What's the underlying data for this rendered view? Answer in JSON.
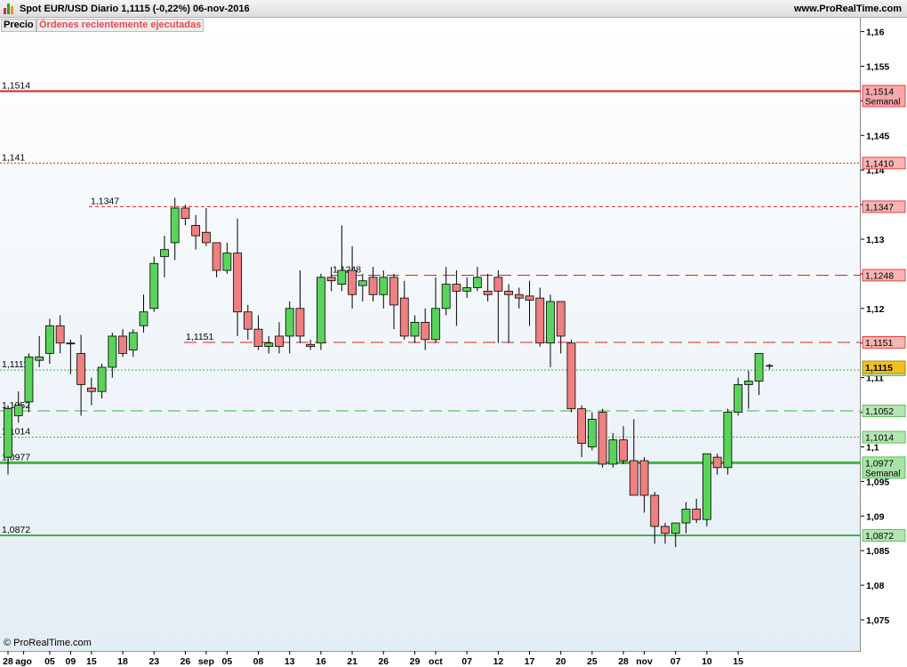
{
  "header": {
    "title": "Spot EUR/USD   Diario   1,1115 (-0,22%)   06-nov-2016",
    "site": "www.ProRealTime.com"
  },
  "tabs": {
    "price": "Precio",
    "orders": "Órdenes recientemente ejecutadas"
  },
  "footer": {
    "credit": "© ProRealTime.com"
  },
  "colors": {
    "up": "#5ad35a",
    "down": "#ef8080",
    "resistance": "#e02020",
    "support": "#3cb83c"
  },
  "chart_data": {
    "type": "candlestick",
    "title": "Spot EUR/USD",
    "period": "Diario",
    "last": "1,1115",
    "change": "-0,22%",
    "date": "06-nov-2016",
    "y_range": [
      1.0705,
      1.162
    ],
    "y_ticks": [
      "1,16",
      "1,155",
      "1,15",
      "1,145",
      "1,14",
      "1,135",
      "1,13",
      "1,125",
      "1,12",
      "1,115",
      "1,11",
      "1,105",
      "1,1",
      "1,095",
      "1,09",
      "1,085",
      "1,08",
      "1,075"
    ],
    "y_tick_values": [
      1.16,
      1.155,
      1.15,
      1.145,
      1.14,
      1.135,
      1.13,
      1.125,
      1.12,
      1.115,
      1.11,
      1.105,
      1.1,
      1.095,
      1.09,
      1.085,
      1.08,
      1.075
    ],
    "x_ticks": [
      {
        "label": "28",
        "i": 0
      },
      {
        "label": "ago",
        "i": 1.5
      },
      {
        "label": "05",
        "i": 4
      },
      {
        "label": "09",
        "i": 6
      },
      {
        "label": "15",
        "i": 8
      },
      {
        "label": "18",
        "i": 11
      },
      {
        "label": "23",
        "i": 14
      },
      {
        "label": "26",
        "i": 17
      },
      {
        "label": "sep",
        "i": 19
      },
      {
        "label": "05",
        "i": 21
      },
      {
        "label": "08",
        "i": 24
      },
      {
        "label": "13",
        "i": 27
      },
      {
        "label": "16",
        "i": 30
      },
      {
        "label": "21",
        "i": 33
      },
      {
        "label": "26",
        "i": 36
      },
      {
        "label": "29",
        "i": 39
      },
      {
        "label": "oct",
        "i": 41
      },
      {
        "label": "07",
        "i": 44
      },
      {
        "label": "12",
        "i": 47
      },
      {
        "label": "17",
        "i": 50
      },
      {
        "label": "20",
        "i": 53
      },
      {
        "label": "25",
        "i": 56
      },
      {
        "label": "28",
        "i": 59
      },
      {
        "label": "nov",
        "i": 61
      },
      {
        "label": "07",
        "i": 64
      },
      {
        "label": "10",
        "i": 67
      },
      {
        "label": "15",
        "i": 70
      }
    ],
    "levels": [
      {
        "value": 1.1514,
        "label": "1,1514",
        "tag": "1,1514",
        "tag2": "Semanal",
        "color": "#e02020",
        "style": "solid",
        "width": 2,
        "label_x": 0,
        "tag_bg": "#f6a8a8"
      },
      {
        "value": 1.141,
        "label": "1,141",
        "tag": "1,1410",
        "color": "#e02020",
        "style": "dotted",
        "width": 1,
        "label_x": 0,
        "tag_bg": "#f6b4b4"
      },
      {
        "value": 1.1347,
        "label": "1,1347",
        "tag": "1,1347",
        "color": "#e02020",
        "style": "dashed-short",
        "width": 1,
        "label_x": 100,
        "tag_bg": "#f6b4b4"
      },
      {
        "value": 1.1248,
        "label": "1,1248",
        "tag": "1,1248",
        "color": "#e02020",
        "style": "dashed-long",
        "width": 1,
        "label_x": 372,
        "tag_bg": "#f6b4b4"
      },
      {
        "value": 1.1151,
        "label": "1,1151",
        "tag": "1,1151",
        "color": "#e02020",
        "style": "dashed-long",
        "width": 1,
        "label_x": 207,
        "tag_bg": "#f6b4b4"
      },
      {
        "value": 1.1111,
        "label": "1,1111",
        "tag": "1,1111",
        "color": "#3cb83c",
        "style": "dotted",
        "width": 1,
        "label_x": 0,
        "tag_bg": "#b4e6b4"
      },
      {
        "value": 1.1052,
        "label": "1,1052",
        "tag": "1,1052",
        "color": "#3cb83c",
        "style": "dashed-long",
        "width": 1,
        "label_x": 0,
        "tag_bg": "#b4e6b4"
      },
      {
        "value": 1.1014,
        "label": "1,1014",
        "tag": "1,1014",
        "color": "#3cb83c",
        "style": "dotted",
        "width": 1,
        "label_x": 0,
        "tag_bg": "#b4e6b4"
      },
      {
        "value": 1.0977,
        "label": "1,0977",
        "tag": "1,0977",
        "tag2": "Semanal",
        "color": "#3cb83c",
        "style": "solid",
        "width": 3,
        "label_x": 0,
        "tag_bg": "#a8e2a8"
      },
      {
        "value": 1.0872,
        "label": "1,0872",
        "tag": "1,0872",
        "color": "#3cb83c",
        "style": "solid",
        "width": 2,
        "label_x": 0,
        "tag_bg": "#b4e6b4"
      }
    ],
    "current_price": {
      "value": 1.1115,
      "tag": "1,1115",
      "bg": "#f0c020"
    },
    "candles": [
      {
        "o": 1.0985,
        "h": 1.106,
        "l": 1.096,
        "c": 1.1055
      },
      {
        "o": 1.1045,
        "h": 1.108,
        "l": 1.1035,
        "c": 1.106
      },
      {
        "o": 1.1065,
        "h": 1.1135,
        "l": 1.105,
        "c": 1.113
      },
      {
        "o": 1.1125,
        "h": 1.116,
        "l": 1.1115,
        "c": 1.113
      },
      {
        "o": 1.1135,
        "h": 1.1185,
        "l": 1.112,
        "c": 1.1175
      },
      {
        "o": 1.1175,
        "h": 1.119,
        "l": 1.1135,
        "c": 1.115
      },
      {
        "o": 1.115,
        "h": 1.1155,
        "l": 1.1105,
        "c": 1.115
      },
      {
        "o": 1.1135,
        "h": 1.1162,
        "l": 1.1045,
        "c": 1.109
      },
      {
        "o": 1.1085,
        "h": 1.11,
        "l": 1.106,
        "c": 1.108
      },
      {
        "o": 1.108,
        "h": 1.112,
        "l": 1.107,
        "c": 1.1115
      },
      {
        "o": 1.1115,
        "h": 1.1165,
        "l": 1.11,
        "c": 1.116
      },
      {
        "o": 1.116,
        "h": 1.117,
        "l": 1.113,
        "c": 1.1135
      },
      {
        "o": 1.114,
        "h": 1.117,
        "l": 1.113,
        "c": 1.1165
      },
      {
        "o": 1.1175,
        "h": 1.122,
        "l": 1.1165,
        "c": 1.1195
      },
      {
        "o": 1.12,
        "h": 1.1275,
        "l": 1.1195,
        "c": 1.1265
      },
      {
        "o": 1.1275,
        "h": 1.1305,
        "l": 1.1245,
        "c": 1.1285
      },
      {
        "o": 1.1295,
        "h": 1.136,
        "l": 1.127,
        "c": 1.1345
      },
      {
        "o": 1.1345,
        "h": 1.135,
        "l": 1.132,
        "c": 1.133
      },
      {
        "o": 1.132,
        "h": 1.1335,
        "l": 1.1285,
        "c": 1.1305
      },
      {
        "o": 1.131,
        "h": 1.1345,
        "l": 1.129,
        "c": 1.1295
      },
      {
        "o": 1.1295,
        "h": 1.129,
        "l": 1.1245,
        "c": 1.1255
      },
      {
        "o": 1.1255,
        "h": 1.1295,
        "l": 1.125,
        "c": 1.128
      },
      {
        "o": 1.128,
        "h": 1.133,
        "l": 1.116,
        "c": 1.1195
      },
      {
        "o": 1.1195,
        "h": 1.1205,
        "l": 1.1155,
        "c": 1.117
      },
      {
        "o": 1.117,
        "h": 1.119,
        "l": 1.114,
        "c": 1.1145
      },
      {
        "o": 1.1145,
        "h": 1.116,
        "l": 1.1135,
        "c": 1.115
      },
      {
        "o": 1.116,
        "h": 1.118,
        "l": 1.1135,
        "c": 1.1145
      },
      {
        "o": 1.116,
        "h": 1.121,
        "l": 1.1135,
        "c": 1.12
      },
      {
        "o": 1.12,
        "h": 1.1255,
        "l": 1.115,
        "c": 1.116
      },
      {
        "o": 1.1148,
        "h": 1.1155,
        "l": 1.114,
        "c": 1.1145
      },
      {
        "o": 1.115,
        "h": 1.125,
        "l": 1.114,
        "c": 1.1245
      },
      {
        "o": 1.1245,
        "h": 1.126,
        "l": 1.1225,
        "c": 1.124
      },
      {
        "o": 1.1235,
        "h": 1.132,
        "l": 1.1225,
        "c": 1.1255
      },
      {
        "o": 1.1255,
        "h": 1.129,
        "l": 1.12,
        "c": 1.122
      },
      {
        "o": 1.1233,
        "h": 1.125,
        "l": 1.121,
        "c": 1.124
      },
      {
        "o": 1.1245,
        "h": 1.126,
        "l": 1.121,
        "c": 1.122
      },
      {
        "o": 1.122,
        "h": 1.1255,
        "l": 1.12,
        "c": 1.1245
      },
      {
        "o": 1.1245,
        "h": 1.125,
        "l": 1.117,
        "c": 1.1205
      },
      {
        "o": 1.1215,
        "h": 1.124,
        "l": 1.1155,
        "c": 1.116
      },
      {
        "o": 1.116,
        "h": 1.119,
        "l": 1.115,
        "c": 1.118
      },
      {
        "o": 1.118,
        "h": 1.12,
        "l": 1.114,
        "c": 1.1155
      },
      {
        "o": 1.1155,
        "h": 1.1245,
        "l": 1.115,
        "c": 1.12
      },
      {
        "o": 1.12,
        "h": 1.126,
        "l": 1.119,
        "c": 1.1235
      },
      {
        "o": 1.1235,
        "h": 1.1255,
        "l": 1.1175,
        "c": 1.1225
      },
      {
        "o": 1.1225,
        "h": 1.1245,
        "l": 1.1215,
        "c": 1.123
      },
      {
        "o": 1.123,
        "h": 1.126,
        "l": 1.1225,
        "c": 1.1245
      },
      {
        "o": 1.1225,
        "h": 1.125,
        "l": 1.121,
        "c": 1.122
      },
      {
        "o": 1.1245,
        "h": 1.1255,
        "l": 1.115,
        "c": 1.1225
      },
      {
        "o": 1.1225,
        "h": 1.1235,
        "l": 1.115,
        "c": 1.122
      },
      {
        "o": 1.122,
        "h": 1.123,
        "l": 1.12,
        "c": 1.1215
      },
      {
        "o": 1.1218,
        "h": 1.124,
        "l": 1.1175,
        "c": 1.1212
      },
      {
        "o": 1.1215,
        "h": 1.123,
        "l": 1.1145,
        "c": 1.115
      },
      {
        "o": 1.115,
        "h": 1.122,
        "l": 1.1115,
        "c": 1.121
      },
      {
        "o": 1.121,
        "h": 1.1205,
        "l": 1.1135,
        "c": 1.116
      },
      {
        "o": 1.115,
        "h": 1.1155,
        "l": 1.105,
        "c": 1.1055
      },
      {
        "o": 1.1055,
        "h": 1.106,
        "l": 1.0985,
        "c": 1.1005
      },
      {
        "o": 1.1,
        "h": 1.105,
        "l": 1.0995,
        "c": 1.104
      },
      {
        "o": 1.105,
        "h": 1.1055,
        "l": 1.097,
        "c": 1.0975
      },
      {
        "o": 1.0975,
        "h": 1.102,
        "l": 1.097,
        "c": 1.101
      },
      {
        "o": 1.101,
        "h": 1.103,
        "l": 1.0975,
        "c": 1.098
      },
      {
        "o": 1.098,
        "h": 1.104,
        "l": 1.096,
        "c": 1.093
      },
      {
        "o": 1.098,
        "h": 1.0985,
        "l": 1.0905,
        "c": 1.093
      },
      {
        "o": 1.093,
        "h": 1.0935,
        "l": 1.086,
        "c": 1.0885
      },
      {
        "o": 1.0885,
        "h": 1.089,
        "l": 1.086,
        "c": 1.0875
      },
      {
        "o": 1.0875,
        "h": 1.089,
        "l": 1.0855,
        "c": 1.089
      },
      {
        "o": 1.089,
        "h": 1.092,
        "l": 1.0875,
        "c": 1.091
      },
      {
        "o": 1.091,
        "h": 1.0925,
        "l": 1.089,
        "c": 1.0895
      },
      {
        "o": 1.0895,
        "h": 1.099,
        "l": 1.0885,
        "c": 1.099
      },
      {
        "o": 1.0985,
        "h": 1.099,
        "l": 1.096,
        "c": 1.097
      },
      {
        "o": 1.097,
        "h": 1.1055,
        "l": 1.096,
        "c": 1.105
      },
      {
        "o": 1.105,
        "h": 1.11,
        "l": 1.1045,
        "c": 1.109
      },
      {
        "o": 1.109,
        "h": 1.111,
        "l": 1.1055,
        "c": 1.1095
      },
      {
        "o": 1.1095,
        "h": 1.113,
        "l": 1.1075,
        "c": 1.1135
      },
      {
        "o": 1.1117,
        "h": 1.112,
        "l": 1.1112,
        "c": 1.1115
      }
    ]
  }
}
